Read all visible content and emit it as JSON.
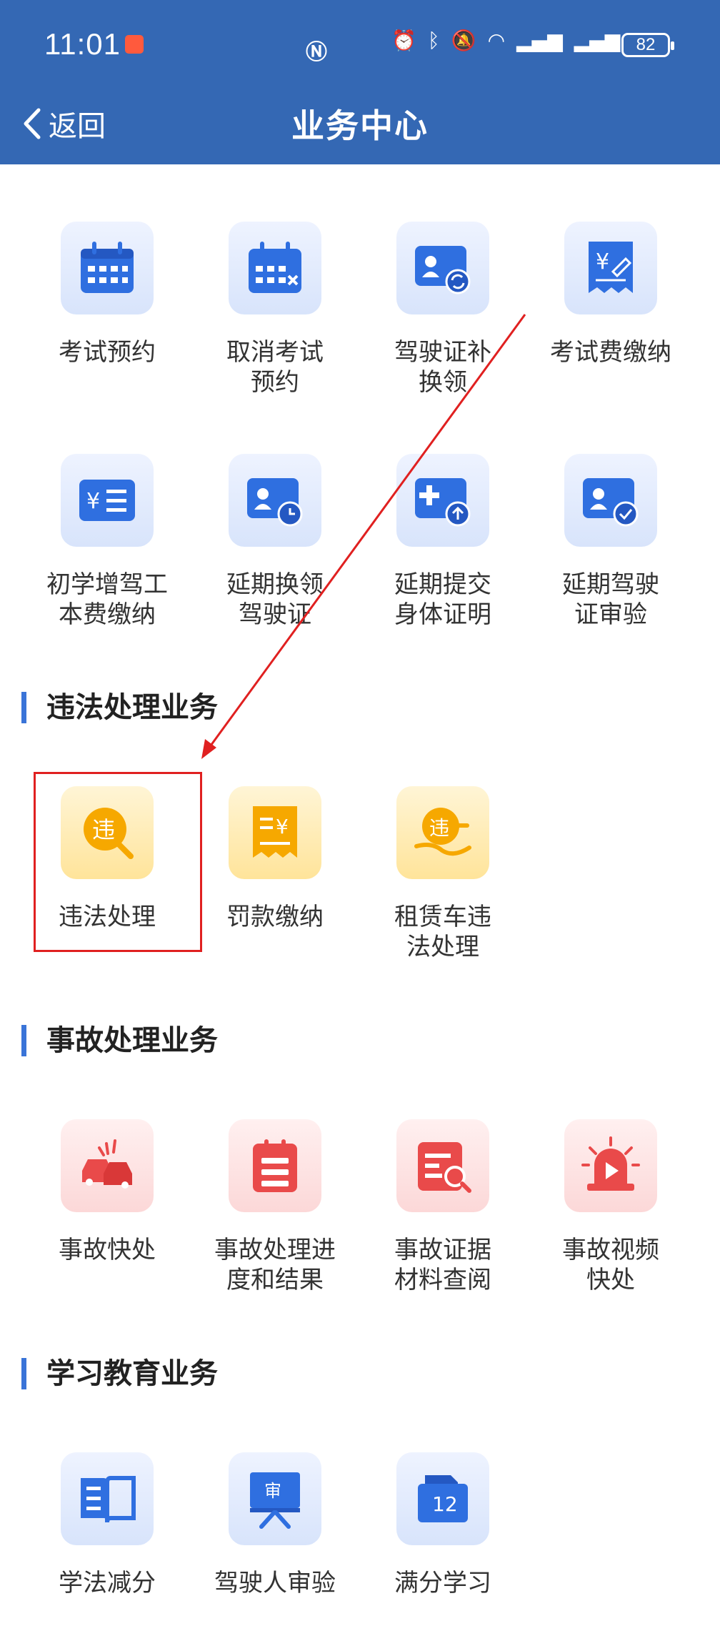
{
  "status_bar": {
    "time": "11:01",
    "battery": "82"
  },
  "header": {
    "back_label": "返回",
    "title": "业务中心"
  },
  "license_services": {
    "items": [
      {
        "label": "考试预约",
        "icon": "calendar-icon"
      },
      {
        "label": "取消考试预约",
        "icon": "calendar-cancel-icon"
      },
      {
        "label": "驾驶证补换领",
        "icon": "license-refresh-icon"
      },
      {
        "label": "考试费缴纳",
        "icon": "receipt-yuan-icon"
      },
      {
        "label": "初学增驾工本费缴纳",
        "icon": "yuan-list-icon"
      },
      {
        "label": "延期换领驾驶证",
        "icon": "license-clock-icon"
      },
      {
        "label": "延期提交身体证明",
        "icon": "medical-upload-icon"
      },
      {
        "label": "延期驾驶证审验",
        "icon": "license-check-icon"
      }
    ]
  },
  "violation_section": {
    "title": "违法处理业务",
    "items": [
      {
        "label": "违法处理",
        "icon": "violation-search-icon"
      },
      {
        "label": "罚款缴纳",
        "icon": "fine-receipt-icon"
      },
      {
        "label": "租赁车违法处理",
        "icon": "rental-violation-icon"
      }
    ]
  },
  "accident_section": {
    "title": "事故处理业务",
    "items": [
      {
        "label": "事故快处",
        "icon": "car-collision-icon"
      },
      {
        "label": "事故处理进度和结果",
        "icon": "clipboard-icon"
      },
      {
        "label": "事故证据材料查阅",
        "icon": "document-search-icon"
      },
      {
        "label": "事故视频快处",
        "icon": "siren-video-icon"
      }
    ]
  },
  "education_section": {
    "title": "学习教育业务",
    "items": [
      {
        "label": "学法减分",
        "icon": "book-icon"
      },
      {
        "label": "驾驶人审验",
        "icon": "review-board-icon"
      },
      {
        "label": "满分学习",
        "icon": "calendar-12-icon"
      }
    ]
  },
  "colors": {
    "header": "#3468b4",
    "accent": "#3a74d8",
    "highlight": "#e02020"
  }
}
